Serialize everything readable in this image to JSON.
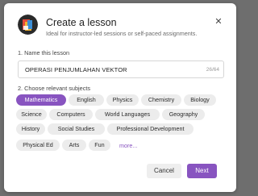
{
  "dialog": {
    "title": "Create a lesson",
    "subtitle": "Ideal for instructor-led sessions or self-paced assignments.",
    "close_icon": "close-icon",
    "logo_icon": "lesson-logo-icon"
  },
  "name_section": {
    "label": "1. Name this lesson",
    "value": "OPERASI PENJUMLAHAN VEKTOR",
    "counter": "26/64"
  },
  "subjects_section": {
    "label": "2. Choose relevant subjects",
    "subjects": [
      {
        "label": "Mathematics",
        "selected": true
      },
      {
        "label": "English",
        "selected": false
      },
      {
        "label": "Physics",
        "selected": false
      },
      {
        "label": "Chemistry",
        "selected": false
      },
      {
        "label": "Biology",
        "selected": false
      },
      {
        "label": "Science",
        "selected": false
      },
      {
        "label": "Computers",
        "selected": false
      },
      {
        "label": "World Languages",
        "selected": false
      },
      {
        "label": "Geography",
        "selected": false
      },
      {
        "label": "History",
        "selected": false
      },
      {
        "label": "Social Studies",
        "selected": false
      },
      {
        "label": "Professional Development",
        "selected": false
      },
      {
        "label": "Physical Ed",
        "selected": false
      },
      {
        "label": "Arts",
        "selected": false
      },
      {
        "label": "Fun",
        "selected": false
      }
    ],
    "more_label": "more..."
  },
  "footer": {
    "cancel_label": "Cancel",
    "next_label": "Next"
  },
  "colors": {
    "accent": "#8854c0",
    "chip_bg": "#ececec",
    "overlay": "#6e6e6e"
  }
}
